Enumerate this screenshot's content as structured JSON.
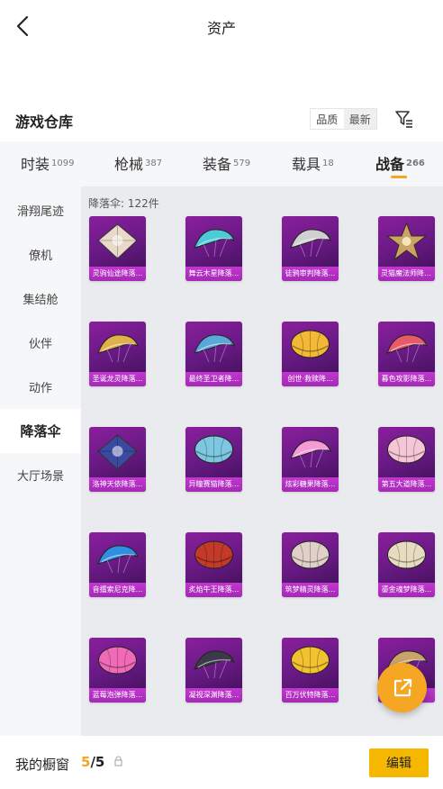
{
  "header": {
    "title": "资产"
  },
  "section": {
    "title": "游戏仓库",
    "sort_options": [
      "品质",
      "最新"
    ],
    "sort_selected": "品质"
  },
  "tabs": [
    {
      "label": "时装",
      "count": "1099"
    },
    {
      "label": "枪械",
      "count": "387"
    },
    {
      "label": "装备",
      "count": "579"
    },
    {
      "label": "载具",
      "count": "18"
    },
    {
      "label": "战备",
      "count": "266"
    }
  ],
  "sidebar": {
    "items": [
      {
        "label": "滑翔尾迹"
      },
      {
        "label": "僚机"
      },
      {
        "label": "集结舱"
      },
      {
        "label": "伙伴"
      },
      {
        "label": "动作"
      },
      {
        "label": "降落伞"
      },
      {
        "label": "大厅场景"
      }
    ]
  },
  "content": {
    "count_label": "降落伞: 122件",
    "items": [
      {
        "name": "灵驹仙途降落...",
        "color": "#e8d9c8",
        "shape": "diamond"
      },
      {
        "name": "舞云木星降落...",
        "color": "#4ec9d6",
        "shape": "wing"
      },
      {
        "name": "徒鸦审判降落...",
        "color": "#d0d0d0",
        "shape": "wing"
      },
      {
        "name": "灵猫魔法师降落...",
        "color": "#c9a36a",
        "shape": "star"
      },
      {
        "name": "圣诞龙灵降落...",
        "color": "#e0b04a",
        "shape": "wing"
      },
      {
        "name": "最终圣卫者降...",
        "color": "#5aa7d8",
        "shape": "wing"
      },
      {
        "name": "创世·救赎降...",
        "color": "#f2b836",
        "shape": "dome"
      },
      {
        "name": "暮色攻影降落...",
        "color": "#e65a6a",
        "shape": "wing"
      },
      {
        "name": "洛神天依降落...",
        "color": "#3a4aa0",
        "shape": "diamond"
      },
      {
        "name": "异瞳赛猫降落...",
        "color": "#7dc8e0",
        "shape": "dome"
      },
      {
        "name": "炫彩糖果降落...",
        "color": "#f59bd6",
        "shape": "wing"
      },
      {
        "name": "第五大道降落...",
        "color": "#f5c6d6",
        "shape": "dome"
      },
      {
        "name": "音擂索尼克降...",
        "color": "#2f8fe0",
        "shape": "wing"
      },
      {
        "name": "炙焰牛王降落...",
        "color": "#c43a2a",
        "shape": "dome"
      },
      {
        "name": "筑梦精灵降落...",
        "color": "#e0d0c8",
        "shape": "dome"
      },
      {
        "name": "鎏金魂梦降落...",
        "color": "#e8dcc0",
        "shape": "dome"
      },
      {
        "name": "蓝莓泡弹降落...",
        "color": "#f06ab8",
        "shape": "dome"
      },
      {
        "name": "凝视深渊降落...",
        "color": "#3a3a4a",
        "shape": "wing"
      },
      {
        "name": "百万伏特降落...",
        "color": "#f2c230",
        "shape": "dome"
      },
      {
        "name": "",
        "color": "#c9a36a",
        "shape": "wing"
      }
    ]
  },
  "bottom": {
    "label": "我的橱窗",
    "count_current": "5",
    "count_sep_total": "/5",
    "edit_label": "编辑"
  },
  "colors": {
    "accent": "#f5a623",
    "button": "#f5b700",
    "card": "#7a1e92"
  }
}
